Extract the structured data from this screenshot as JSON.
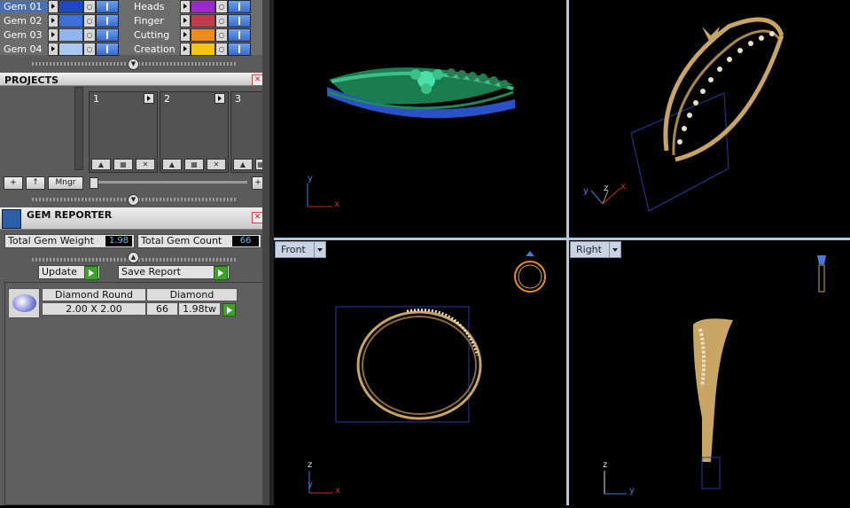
{
  "gems": [
    {
      "label": "Gem 01",
      "color": "#1e47c8",
      "selected": true
    },
    {
      "label": "Gem 02",
      "color": "#3c6fdc",
      "selected": false
    },
    {
      "label": "Gem 03",
      "color": "#8fb6f0",
      "selected": false
    },
    {
      "label": "Gem 04",
      "color": "#a9c8f3",
      "selected": false
    }
  ],
  "layers": [
    {
      "label": "Heads",
      "color": "#9a2ad0"
    },
    {
      "label": "Finger",
      "color": "#c23c4c"
    },
    {
      "label": "Cutting",
      "color": "#f08a18"
    },
    {
      "label": "Creation",
      "color": "#f6c21c"
    }
  ],
  "projects": {
    "title": "PROJECTS",
    "slots": [
      "1",
      "2",
      "3"
    ],
    "add_label": "+",
    "up_label": "↑",
    "mngr_label": "Mngr",
    "zoom_plus": "+"
  },
  "gem_reporter": {
    "title": "GEM REPORTER",
    "total_weight_label": "Total Gem Weight",
    "total_weight_value": "1.98",
    "total_count_label": "Total Gem Count",
    "total_count_value": "66",
    "update_label": "Update",
    "save_report_label": "Save Report",
    "rows": [
      {
        "shape": "Diamond Round",
        "size": "2.00 X 2.00",
        "material": "Diamond",
        "count": "66",
        "weight": "1.98tw"
      }
    ]
  },
  "viewports": {
    "top_left": {
      "axis_y": "y",
      "axis_x": "x"
    },
    "top_right": {
      "axis_y": "y",
      "axis_z": "z",
      "axis_x": "x"
    },
    "front": {
      "label": "Front",
      "axis_z": "z",
      "axis_y": "y",
      "axis_x": "x"
    },
    "right": {
      "label": "Right",
      "axis_z": "z",
      "axis_y": "y"
    }
  },
  "colors": {
    "gold": "#c9a564",
    "green_render": "#1e8a5a",
    "blue_gems": "#2a52c8",
    "axis_red": "#c0302a",
    "axis_blue": "#4a7ad8",
    "viewport_border": "#b6c8dd"
  }
}
